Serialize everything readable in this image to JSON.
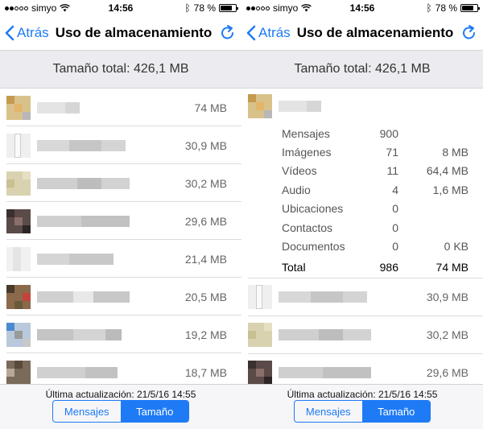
{
  "status": {
    "carrier": "simyo",
    "time": "14:56",
    "battery": "78 %",
    "battery_level": 0.78
  },
  "nav": {
    "back_label": "Atrás",
    "title": "Uso de almacenamiento"
  },
  "total_label": "Tamaño total: 426,1 MB",
  "left_rows": [
    {
      "size": "74 MB"
    },
    {
      "size": "30,9 MB"
    },
    {
      "size": "30,2 MB"
    },
    {
      "size": "29,6 MB"
    },
    {
      "size": "21,4 MB"
    },
    {
      "size": "20,5 MB"
    },
    {
      "size": "19,2 MB"
    },
    {
      "size": "18,7 MB"
    }
  ],
  "details": {
    "rows": [
      {
        "label": "Mensajes",
        "count": "900",
        "size": ""
      },
      {
        "label": "Imágenes",
        "count": "71",
        "size": "8 MB"
      },
      {
        "label": "Vídeos",
        "count": "11",
        "size": "64,4 MB"
      },
      {
        "label": "Audio",
        "count": "4",
        "size": "1,6 MB"
      },
      {
        "label": "Ubicaciones",
        "count": "0",
        "size": ""
      },
      {
        "label": "Contactos",
        "count": "0",
        "size": ""
      },
      {
        "label": "Documentos",
        "count": "0",
        "size": "0 KB"
      },
      {
        "label": "Total",
        "count": "986",
        "size": "74 MB"
      }
    ]
  },
  "right_rows": [
    {
      "size": "30,9 MB"
    },
    {
      "size": "30,2 MB"
    },
    {
      "size": "29,6 MB"
    }
  ],
  "bottom": {
    "last_update": "Última actualización: 21/5/16 14:55",
    "seg_messages": "Mensajes",
    "seg_size": "Tamaño"
  },
  "colors": {
    "accent": "#1E7AF5",
    "header_bg": "#EBEBF0"
  }
}
